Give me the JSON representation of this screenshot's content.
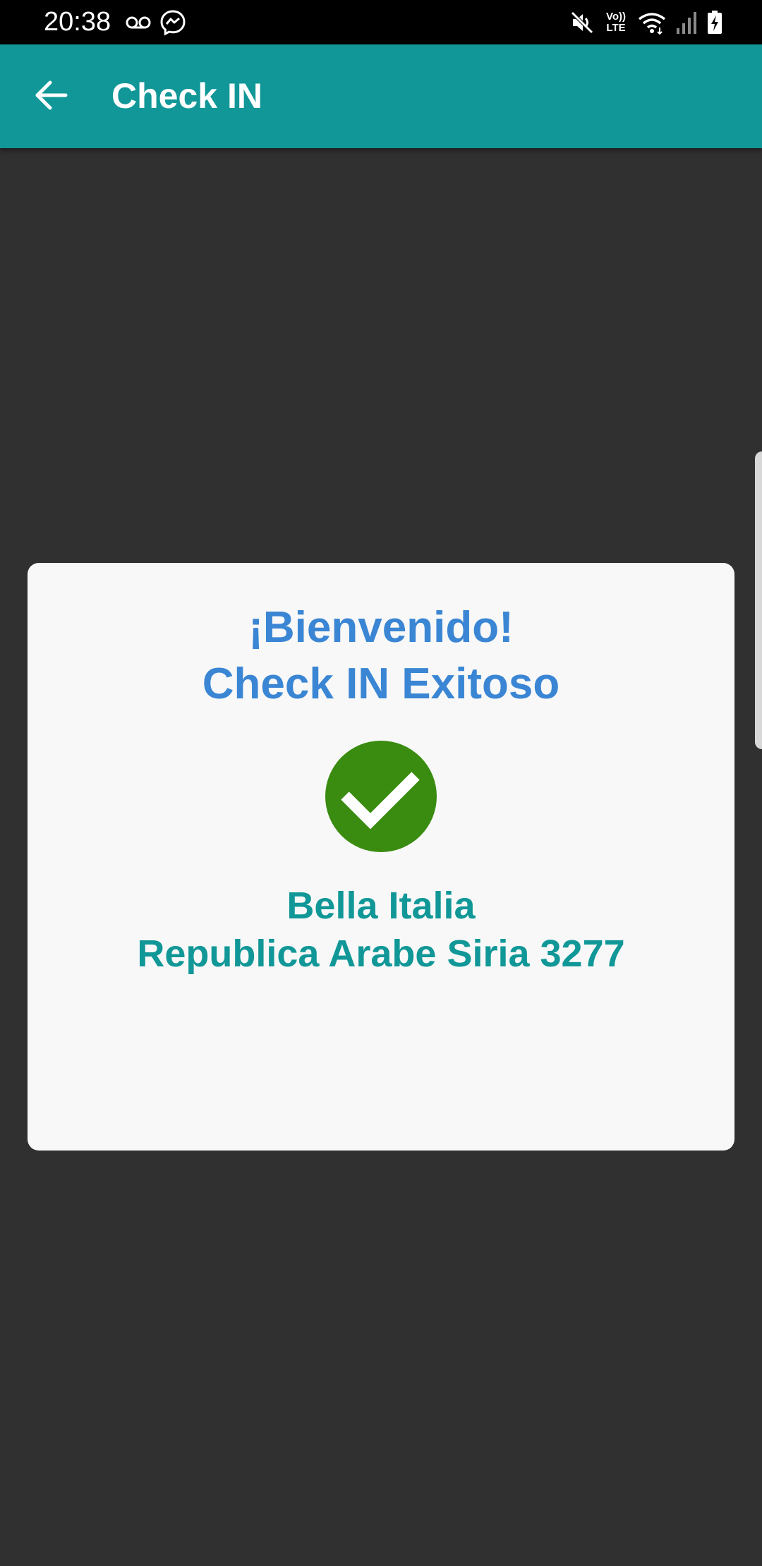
{
  "status_bar": {
    "time": "20:38",
    "network_label": "Vo)) LTE",
    "icons": [
      "voicemail-icon",
      "messenger-icon",
      "mute-icon",
      "volte-icon",
      "wifi-icon",
      "signal-icon",
      "battery-charging-icon"
    ]
  },
  "app_bar": {
    "title": "Check IN",
    "back_icon": "arrow-back-icon",
    "color": "#119797"
  },
  "dialog": {
    "welcome_line1": "¡Bienvenido!",
    "welcome_line2": "Check IN Exitoso",
    "success_icon": "check-circle-icon",
    "venue_name": "Bella Italia",
    "venue_address": "Republica Arabe Siria 3277",
    "title_color": "#3a86d4",
    "venue_color": "#119797",
    "success_color": "#3a8c10"
  }
}
